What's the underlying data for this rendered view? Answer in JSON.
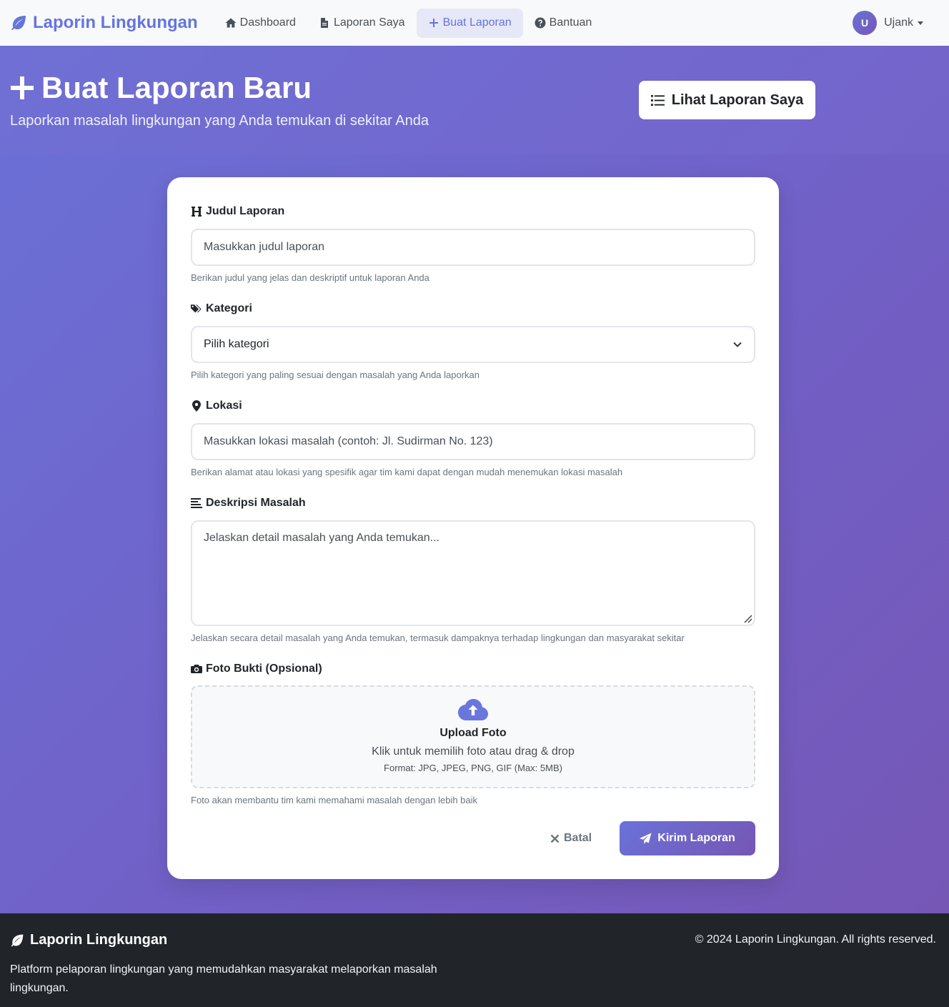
{
  "navbar": {
    "brand": "Laporin Lingkungan",
    "links": [
      {
        "label": "Dashboard",
        "icon": "home-icon"
      },
      {
        "label": "Laporan Saya",
        "icon": "file-icon"
      },
      {
        "label": "Buat Laporan",
        "icon": "plus-icon",
        "active": true
      },
      {
        "label": "Bantuan",
        "icon": "question-circle-icon"
      }
    ],
    "user": {
      "initial": "U",
      "name": "Ujank"
    }
  },
  "hero": {
    "title": "Buat Laporan Baru",
    "subtitle": "Laporkan masalah lingkungan yang Anda temukan di sekitar Anda",
    "button_label": "Lihat Laporan Saya"
  },
  "form": {
    "judul": {
      "label": "Judul Laporan",
      "placeholder": "Masukkan judul laporan",
      "help": "Berikan judul yang jelas dan deskriptif untuk laporan Anda"
    },
    "kategori": {
      "label": "Kategori",
      "selected": "Pilih kategori",
      "help": "Pilih kategori yang paling sesuai dengan masalah yang Anda laporkan"
    },
    "lokasi": {
      "label": "Lokasi",
      "placeholder": "Masukkan lokasi masalah (contoh: Jl. Sudirman No. 123)",
      "help": "Berikan alamat atau lokasi yang spesifik agar tim kami dapat dengan mudah menemukan lokasi masalah"
    },
    "deskripsi": {
      "label": "Deskripsi Masalah",
      "placeholder": "Jelaskan detail masalah yang Anda temukan...",
      "help": "Jelaskan secara detail masalah yang Anda temukan, termasuk dampaknya terhadap lingkungan dan masyarakat sekitar"
    },
    "foto": {
      "label": "Foto Bukti (Opsional)",
      "upload_title": "Upload Foto",
      "upload_sub": "Klik untuk memilih foto atau drag & drop",
      "upload_format": "Format: JPG, JPEG, PNG, GIF (Max: 5MB)",
      "help": "Foto akan membantu tim kami memahami masalah dengan lebih baik"
    },
    "cancel_label": "Batal",
    "submit_label": "Kirim Laporan"
  },
  "footer": {
    "brand": "Laporin Lingkungan",
    "description": "Platform pelaporan lingkungan yang memudahkan masyarakat melaporkan masalah lingkungan.",
    "copyright": "© 2024 Laporin Lingkungan. All rights reserved."
  },
  "colors": {
    "accent": "#6474e0",
    "gradient_start": "#6a72d8",
    "gradient_end": "#7656b4",
    "footer_bg": "#212529"
  }
}
